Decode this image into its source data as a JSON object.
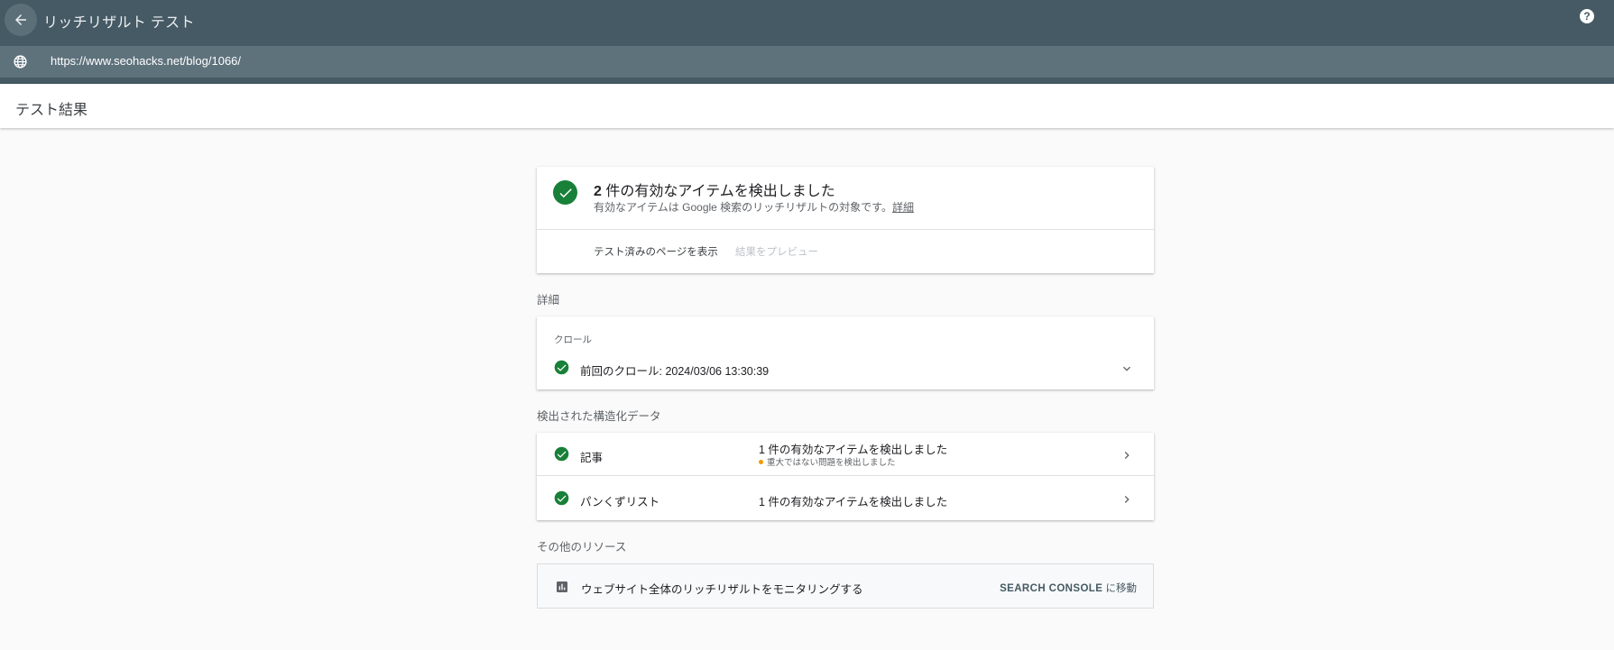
{
  "app": {
    "title": "リッチリザルト テスト",
    "url": "https://www.seohacks.net/blog/1066/"
  },
  "results_header": "テスト結果",
  "summary": {
    "count": "2",
    "headline_rest": " 件の有効なアイテムを検出しました",
    "subtitle": "有効なアイテムは Google 検索のリッチリザルトの対象です。",
    "details_link": "詳細",
    "action_view_page": "テスト済みのページを表示",
    "action_preview": "結果をプレビュー"
  },
  "details_section": {
    "title": "詳細",
    "crawl_label": "クロール",
    "crawl_text": "前回のクロール: 2024/03/06 13:30:39"
  },
  "structured_data": {
    "title": "検出された構造化データ",
    "items": [
      {
        "name": "記事",
        "status": "1 件の有効なアイテムを検出しました",
        "warning": "重大ではない問題を検出しました"
      },
      {
        "name": "パンくずリスト",
        "status": "1 件の有効なアイテムを検出しました"
      }
    ]
  },
  "other_resources": {
    "title": "その他のリソース",
    "text": "ウェブサイト全体のリッチリザルトをモニタリングする",
    "link_bold": "SEARCH CONSOLE",
    "link_suffix": " に移動"
  },
  "colors": {
    "appbar": "#455a64",
    "urlbar": "#5e727c",
    "success": "#188038",
    "warning": "#f29900"
  },
  "icons": [
    "back-arrow-icon",
    "help-icon",
    "globe-icon",
    "check-circle-icon",
    "chevron-down-icon",
    "chevron-right-icon",
    "bar-chart-icon"
  ]
}
